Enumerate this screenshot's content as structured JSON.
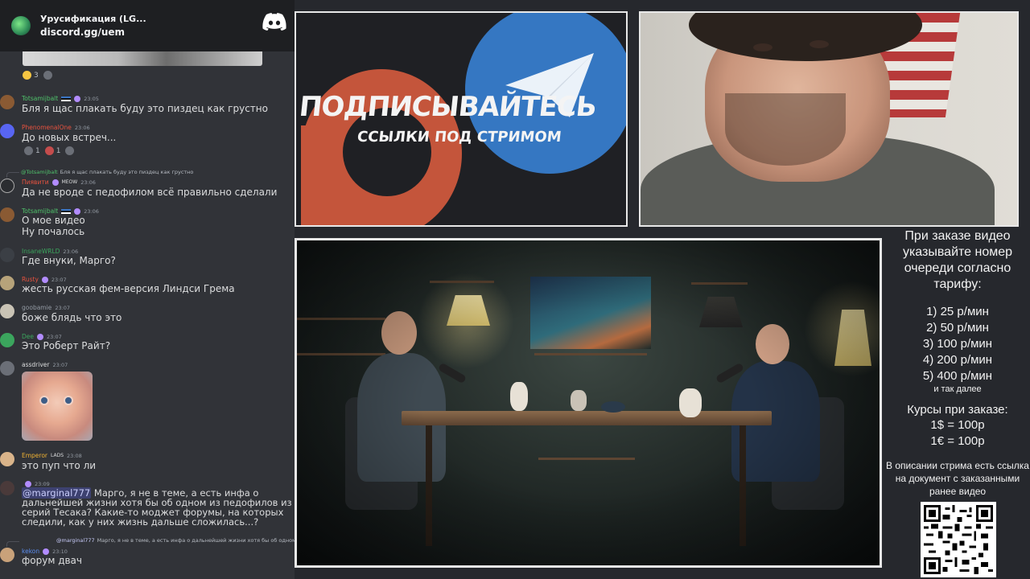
{
  "server": {
    "name": "Урусификация (LG...",
    "invite": "discord.gg/uem",
    "icon": "discord-logo-icon"
  },
  "reactions_top": [
    {
      "emoji": "laugh",
      "count": "3"
    },
    {
      "emoji": "skull",
      "count": ""
    }
  ],
  "messages": [
    {
      "user": "Totsamijbalt",
      "time": "23:05",
      "color": "#4fc36b",
      "text": "Бля я щас плакать буду это пиздец как грустно"
    },
    {
      "user": "PhenomenalOne",
      "time": "23:06",
      "color": "#e8523f",
      "text": "До новых встреч...",
      "reactions": [
        "1",
        "1",
        ""
      ]
    },
    {
      "reply_user": "@Totsamijbalt",
      "reply_text": "Бля я щас плакать буду это пиздец как грустно",
      "user": "Пиявити",
      "extra": "MEOW",
      "time": "23:06",
      "color": "#e8523f",
      "text": "Да не вроде с педофилом всё правильно сделали"
    },
    {
      "user": "Totsamijbalt",
      "time": "23:06",
      "color": "#4fc36b",
      "text": "О мое видео",
      "text2": "Ну почалось"
    },
    {
      "user": "InsaneWRLD",
      "time": "23:06",
      "color": "#3ba55d",
      "text": "Где внуки, Марго?"
    },
    {
      "user": "Rusty",
      "time": "23:07",
      "color": "#e8523f",
      "text": "жесть русская фем-версия Линдси Грема"
    },
    {
      "user": "goobamie",
      "time": "23:07",
      "color": "#949ba4",
      "text": "боже блядь что это"
    },
    {
      "user": "Dee",
      "time": "23:07",
      "color": "#3ba55d",
      "text": "Это Роберт Райт?"
    },
    {
      "user": "assdriver",
      "time": "23:07",
      "color": "#dcddde",
      "text": ""
    },
    {
      "user": "Emperor",
      "extra": "LADS",
      "time": "23:08",
      "color": "#f0b232",
      "text": "это пуп что ли"
    },
    {
      "user": "",
      "time": "23:09",
      "color": "#949ba4",
      "mention": "@marginal777",
      "text": " Марго, я не в теме, а есть инфа о дальнейшей жизни  хотя бы об одном из педофилов из серий Тесака?  Какие-то моджет форумы,  на которых следили, как у них жизнь дальше сложилась...?"
    },
    {
      "reply_user": "@marginal777",
      "reply_text": "Марго, я не в теме, а есть инфа о дальнейшей жизни  хотя бы об одном из",
      "user": "kekon",
      "time": "23:10",
      "color": "#5b8def",
      "text": "форум  двач"
    }
  ],
  "promo": {
    "title": "ПОДПИСЫВАЙТЕСЬ",
    "subtitle": "ССЫЛКИ ПОД СТРИМОМ"
  },
  "side": {
    "title": "При заказе видео указывайте номер очереди согласно тарифу:",
    "tariffs": [
      "1) 25 р/мин",
      "2) 50 р/мин",
      "3) 100 р/мин",
      "4) 200 р/мин",
      "5) 400 р/мин"
    ],
    "more": "и так далее",
    "rates_title": "Курсы при заказе:",
    "rates": [
      "1$ = 100р",
      "1€ = 100р"
    ],
    "description": "В описании стрима есть ссылка на документ с заказанными ранее видео"
  }
}
